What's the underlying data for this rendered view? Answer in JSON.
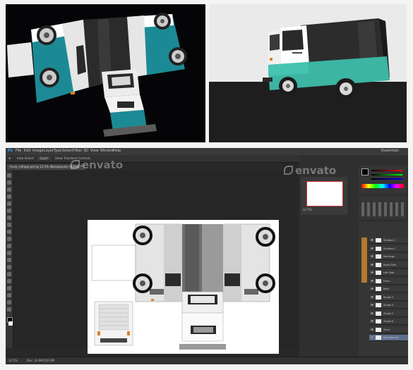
{
  "watermarks": {
    "main": "envato",
    "nav": "envato"
  },
  "photoshop": {
    "menu": [
      "Ps",
      "File",
      "Edit",
      "Image",
      "Layer",
      "Type",
      "Select",
      "Filter",
      "3D",
      "View",
      "Window",
      "Help"
    ],
    "option_bar": [
      "Auto-Select:",
      "Layer",
      "Show Transform Controls"
    ],
    "document_tab": "truck_vintage.psd @ 12.5% (Background, RGB/8) *",
    "workspace": "Essentials",
    "status_zoom": "12.5%",
    "status_doc": "Doc: 24.9M/150.0M",
    "navigator_zoom": "12.5%",
    "layers": [
      {
        "name": "Shadow 1",
        "selected": false
      },
      {
        "name": "Shadow 2",
        "selected": false
      },
      {
        "name": "Markings",
        "selected": false
      },
      {
        "name": "Right Side",
        "selected": false
      },
      {
        "name": "Left Side",
        "selected": false
      },
      {
        "name": "Front",
        "selected": false
      },
      {
        "name": "Back",
        "selected": false
      },
      {
        "name": "Shape 3",
        "selected": false
      },
      {
        "name": "Shape 4",
        "selected": false
      },
      {
        "name": "Shape 5",
        "selected": false
      },
      {
        "name": "Shape 6",
        "selected": false
      },
      {
        "name": "Truck",
        "selected": false
      },
      {
        "name": "Background",
        "selected": true
      }
    ]
  },
  "colors": {
    "teal": "#1f8f96",
    "mint": "#3cb5a3",
    "dark_body": "#2a2a2a",
    "ps_bg": "#282828"
  }
}
